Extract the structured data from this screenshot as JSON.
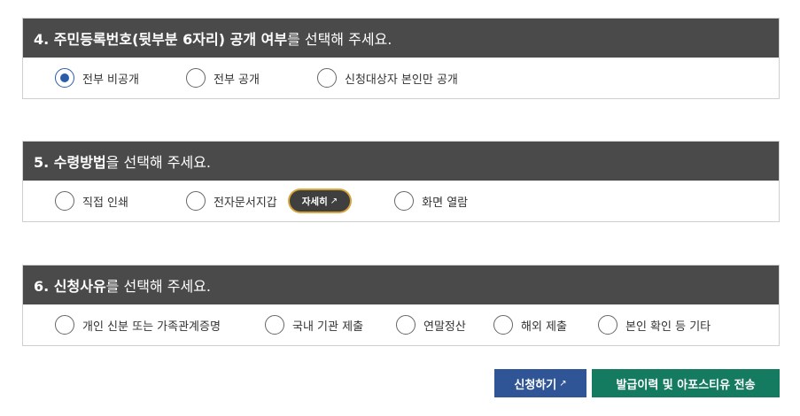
{
  "section4": {
    "title_bold": "4. 주민등록번호(뒷부분 6자리) 공개 여부",
    "title_rest": "를 선택해 주세요.",
    "options": [
      "전부 비공개",
      "전부 공개",
      "신청대상자 본인만 공개"
    ],
    "selected_index": 0
  },
  "section5": {
    "title_bold": "5. 수령방법",
    "title_rest": "을 선택해 주세요.",
    "options": [
      "직접 인쇄",
      "전자문서지갑",
      "화면 열람"
    ],
    "detail_label": "자세히"
  },
  "section6": {
    "title_bold": "6. 신청사유",
    "title_rest": "를 선택해 주세요.",
    "options": [
      "개인 신분 또는 가족관계증명",
      "국내 기관 제출",
      "연말정산",
      "해외 제출",
      "본인 확인 등 기타"
    ]
  },
  "buttons": {
    "apply_label": "신청하기",
    "issue_label": "발급이력 및 아포스티유 전송"
  },
  "colors": {
    "header_bg": "#4a4a4a",
    "radio_selected": "#2a5caa",
    "apply_button": "#2f5597",
    "issue_button": "#147a60",
    "detail_border": "#d6a63a"
  },
  "icons": {
    "external_link": "external-link-icon"
  }
}
